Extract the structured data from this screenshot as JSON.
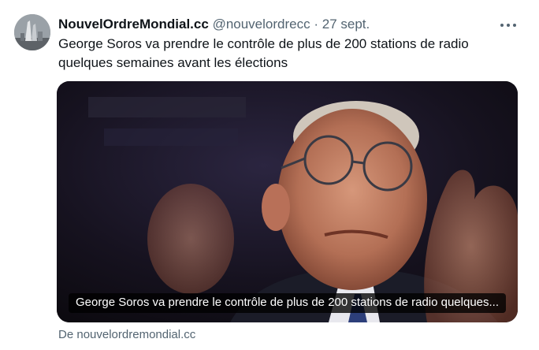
{
  "tweet": {
    "author": {
      "display_name": "NouvelOrdreMondial.cc",
      "handle": "@nouvelordrecc",
      "separator": "·",
      "timestamp": "27 sept."
    },
    "more_icon": "more-horizontal-icon",
    "text": "George Soros va prendre le contrôle de plus de 200 stations de radio quelques semaines avant les élections",
    "card": {
      "caption": "George Soros va prendre le contrôle de plus de 200 stations de radio quelques...",
      "source_prefix": "De",
      "source_host": "nouvelordremondial.cc"
    }
  },
  "colors": {
    "text_primary": "#0f1419",
    "text_secondary": "#536471",
    "background": "#ffffff"
  }
}
